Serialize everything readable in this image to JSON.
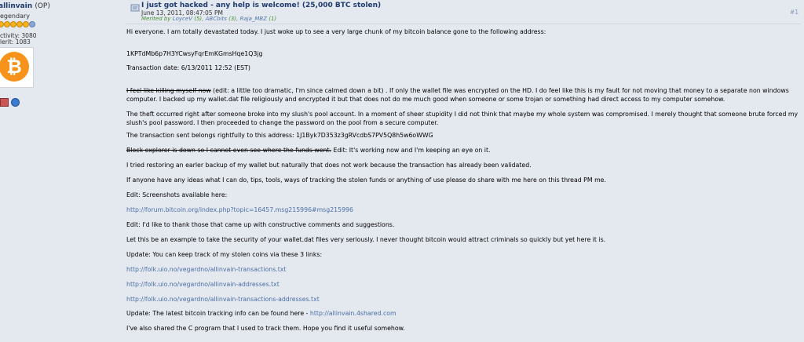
{
  "poster": {
    "name": "allinvain",
    "op_tag": "(OP)",
    "rank": "egendary",
    "activity": "ctivity: 3080",
    "merit": "lerit: 1083",
    "avatar_icon": "bitcoin-logo",
    "icons": [
      "profile-icon",
      "website-icon"
    ]
  },
  "post": {
    "title": "I just got hacked - any help is welcome! (25,000 BTC stolen)",
    "date": "June 13, 2011, 08:47:05 PM",
    "merited_prefix": "Merited by",
    "merits": [
      {
        "user": "LoyceV",
        "count": "(5)"
      },
      {
        "user": "ABCbits",
        "count": "(3)"
      },
      {
        "user": "Raja_MBZ",
        "count": "(1)"
      }
    ],
    "number": "#1"
  },
  "body": {
    "p1": "Hi everyone. I am totally devastated today. I just woke up to see a very large chunk of my bitcoin balance gone to the following address:",
    "address": "1KPTdMb6p7H3YCwsyFqrEmKGmsHqe1Q3jg",
    "tx_date": "Transaction date: 6/13/2011 12:52 (EST)",
    "p2_strike": "I feel like killing myself now",
    "p2_rest": " (edit: a little too dramatic, I'm since calmed down a bit) . If only the wallet file was encrypted on the HD. I do feel like this is my fault for not moving that money to a separate non windows computer. I backed up my wallet.dat file religiously and encrypted it but that does not do me much good when someone or some trojan or something had direct access to my computer somehow.",
    "p3": "The theft occurred right after someone broke into my slush's pool account. In a moment of sheer stupidity I did not think that maybe my whole system was compromised. I merely thought that someone brute forced my slush's pool password. I then proceeded to change the password on the pool from a secure computer.",
    "p4": "The transaction sent belongs rightfully to this address: 1J1Byk7D353z3gRVcdbS7PV5Q8h5w6oWWG",
    "p5_strike": "Block explorer is down so I cannot even see where the funds went.",
    "p5_rest": " Edit: It's working now and I'm keeping an eye on it.",
    "p6": "I tried restoring an earler backup of my wallet but naturally that does not work because the transaction has already been validated.",
    "p7": "If anyone have any ideas what I can do, tips, tools, ways of tracking the stolen funds or anything of use please do share with me here on this thread PM me.",
    "p8": "Edit: Screenshots available here:",
    "link1": "http://forum.bitcoin.org/index.php?topic=16457.msg215996#msg215996",
    "p9": "Edit: I'd like to thank those that came up with constructive comments and suggestions.",
    "p10": "Let this be an example to take the security of your wallet.dat files very seriously. I never thought bitcoin would attract criminals so quickly but yet here it is.",
    "p11": "Update: You can keep track of my stolen coins via these 3 links:",
    "link2": "http://folk.uio.no/vegardno/allinvain-transactions.txt",
    "link3": "http://folk.uio.no/vegardno/allinvain-addresses.txt",
    "link4": "http://folk.uio.no/vegardno/allinvain-transactions-addresses.txt",
    "p12_prefix": "Update: The latest bitcoin tracking info can be found here - ",
    "p12_link": "http://allinvain.4shared.com",
    "p13": "I've also shared the C program that I used to track them. Hope you find it useful somehow."
  }
}
